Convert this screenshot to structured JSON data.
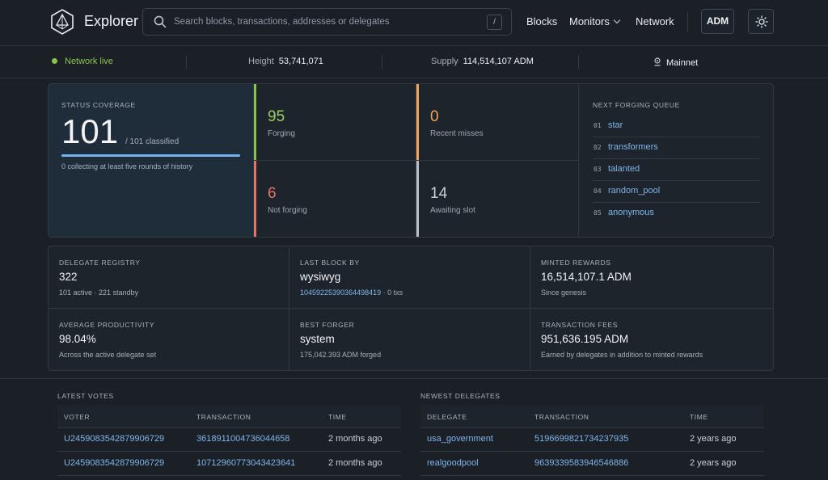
{
  "header": {
    "brand": "Explorer",
    "search_placeholder": "Search blocks, transactions, addresses or delegates",
    "search_shortcut": "/",
    "nav": {
      "blocks": "Blocks",
      "monitors": "Monitors",
      "network": "Network"
    },
    "currency_button": "ADM",
    "icons": {
      "logo": "adamant-logo",
      "search": "search-icon",
      "theme": "sun-icon",
      "monitors": "chevron-down-icon"
    }
  },
  "statusbar": {
    "network_status": "Network live",
    "height_label": "Height",
    "height_value": "53,741,071",
    "supply_label": "Supply",
    "supply_value": "114,514,107 ADM",
    "network_name": "Mainnet",
    "network_icon": "map-pin-icon"
  },
  "coverage": {
    "title": "STATUS COVERAGE",
    "value": "101",
    "total": "/ 101 classified",
    "progress": 1.0,
    "note": "0 collecting at least five rounds of history"
  },
  "status_cells": [
    {
      "value": "95",
      "label": "Forging",
      "color": "#8bc34a"
    },
    {
      "value": "0",
      "label": "Recent misses",
      "color": "#f0a45c"
    },
    {
      "value": "6",
      "label": "Not forging",
      "color": "#e57368"
    },
    {
      "value": "14",
      "label": "Awaiting slot",
      "color": "#b8c0c8"
    }
  ],
  "queue": {
    "title": "NEXT FORGING QUEUE",
    "items": [
      {
        "idx": "01",
        "name": "star"
      },
      {
        "idx": "02",
        "name": "transformers"
      },
      {
        "idx": "03",
        "name": "talanted"
      },
      {
        "idx": "04",
        "name": "random_pool"
      },
      {
        "idx": "05",
        "name": "anonymous"
      }
    ]
  },
  "stats": [
    {
      "title": "DELEGATE REGISTRY",
      "value": "322",
      "sub": "101 active · 221 standby"
    },
    {
      "title": "LAST BLOCK BY",
      "value": "wysiwyg",
      "sub_link": "10459225390364498419",
      "sub": " · 0 txs"
    },
    {
      "title": "MINTED REWARDS",
      "value": "16,514,107.1 ADM",
      "sub": "Since genesis"
    },
    {
      "title": "AVERAGE PRODUCTIVITY",
      "value": "98.04%",
      "sub": "Across the active delegate set"
    },
    {
      "title": "BEST FORGER",
      "value": "system",
      "sub": "175,042.393 ADM forged"
    },
    {
      "title": "TRANSACTION FEES",
      "value": "951,636.195 ADM",
      "sub": "Earned by delegates in addition to minted rewards"
    }
  ],
  "latest_votes": {
    "title": "LATEST VOTES",
    "headers": [
      "VOTER",
      "TRANSACTION",
      "TIME"
    ],
    "rows": [
      [
        "U2459083542879906729",
        "3618911004736044658",
        "2 months ago"
      ],
      [
        "U2459083542879906729",
        "10712960773043423641",
        "2 months ago"
      ]
    ]
  },
  "newest_delegates": {
    "title": "NEWEST DELEGATES",
    "headers": [
      "DELEGATE",
      "TRANSACTION",
      "TIME"
    ],
    "rows": [
      [
        "usa_government",
        "5196699821734237935",
        "2 years ago"
      ],
      [
        "realgoodpool",
        "9639339583946546886",
        "2 years ago"
      ]
    ]
  }
}
